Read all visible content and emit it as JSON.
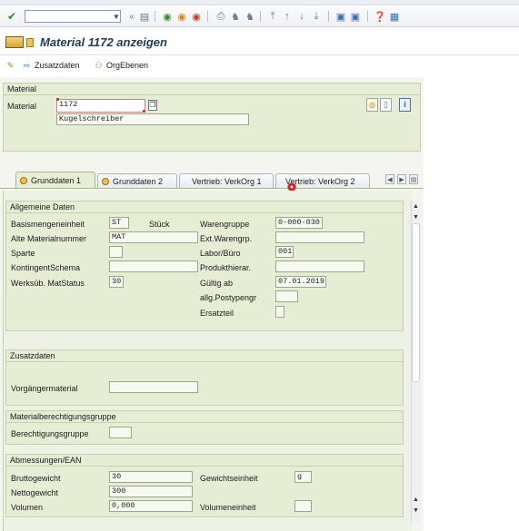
{
  "toolbar": {
    "command_value": "",
    "icons": [
      "check-icon",
      "back-icon",
      "exit-icon",
      "cancel-icon",
      "print-icon",
      "find-icon",
      "find-next-icon",
      "first-page-icon",
      "prev-page-icon",
      "next-page-icon",
      "last-page-icon",
      "new-session-icon",
      "shortcut-icon",
      "help-icon",
      "customize-icon"
    ]
  },
  "title": "Material 1172 anzeigen",
  "app_toolbar": {
    "zusatzdaten": "Zusatzdaten",
    "orgebenen": "OrgEbenen"
  },
  "material_panel": {
    "title": "Material",
    "label": "Material",
    "number": "1172",
    "description": "Kugelschreiber"
  },
  "tabs": [
    {
      "label": "Grunddaten 1",
      "active": true
    },
    {
      "label": "Grunddaten 2",
      "active": false
    },
    {
      "label": "Vertrieb: VerkOrg 1",
      "active": false
    },
    {
      "label": "Vertrieb: VerkOrg 2",
      "active": false
    }
  ],
  "allgemeine": {
    "title": "Allgemeine Daten",
    "basismengeneinheit_label": "Basismengeneinheit",
    "basismengeneinheit_value": "ST",
    "basismengeneinheit_text": "Stück",
    "alte_materialnummer_label": "Alte Materialnummer",
    "alte_materialnummer_value": "MAT",
    "sparte_label": "Sparte",
    "sparte_value": "",
    "kontingent_label": "KontingentSchema",
    "kontingent_value": "",
    "werksub_label": "Werksüb. MatStatus",
    "werksub_value": "30",
    "warengruppe_label": "Warengruppe",
    "warengruppe_value": "0-000-030",
    "ext_warengrp_label": "Ext.Warengrp.",
    "ext_warengrp_value": "",
    "labor_label": "Labor/Büro",
    "labor_value": "001",
    "produkthierar_label": "Produkthierar.",
    "produkthierar_value": "",
    "gueltig_label": "Gültig ab",
    "gueltig_value": "07.01.2019",
    "postypengr_label": "allg.Postypengr",
    "postypengr_value": "",
    "ersatzteil_label": "Ersatzteil",
    "ersatzteil_value": ""
  },
  "zusatzdaten": {
    "title": "Zusatzdaten",
    "vorgaenger_label": "Vorgängermaterial",
    "vorgaenger_value": ""
  },
  "berechtigung": {
    "title": "Materialberechtigungsgruppe",
    "gruppe_label": "Berechtigungsgruppe",
    "gruppe_value": ""
  },
  "abmessungen": {
    "title": "Abmessungen/EAN",
    "brutto_label": "Bruttogewicht",
    "brutto_value": "30",
    "netto_label": "Nettogewicht",
    "netto_value": "300",
    "volumen_label": "Volumen",
    "volumen_value": "0,000",
    "gewichtseinheit_label": "Gewichtseinheit",
    "gewichtseinheit_value": "g",
    "volumeneinheit_label": "Volumeneinheit",
    "volumeneinheit_value": ""
  },
  "colors": {
    "panel_bg": "#e6edd5",
    "panel_border": "#c5d0ad",
    "title_text": "#1d3b55"
  }
}
